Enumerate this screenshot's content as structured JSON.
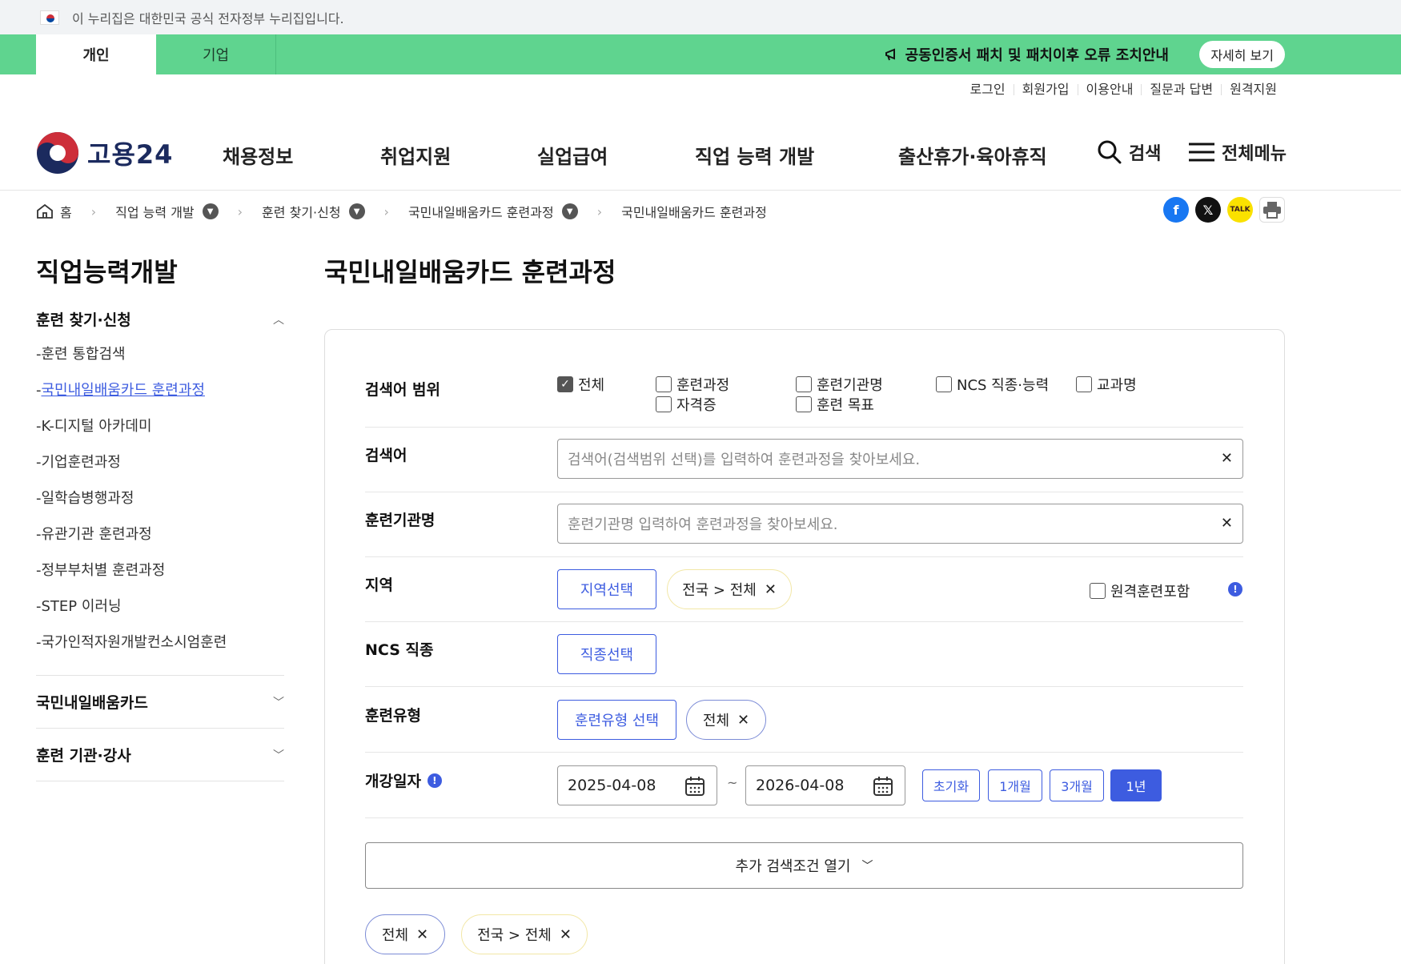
{
  "gov_banner": {
    "text": "이 누리집은 대한민국 공식 전자정부 누리집입니다."
  },
  "topbar": {
    "tab_personal": "개인",
    "tab_business": "기업",
    "notice": "공동인증서 패치 및 패치이후 오류 조치안내",
    "detail_button": "자세히 보기"
  },
  "util_links": [
    "로그인",
    "회원가입",
    "이용안내",
    "질문과 답변",
    "원격지원"
  ],
  "logo": {
    "text": "고용24"
  },
  "gnb": {
    "menus": [
      "채용정보",
      "취업지원",
      "실업급여",
      "직업 능력 개발",
      "출산휴가·육아휴직"
    ],
    "search": "검색",
    "all_menu": "전체메뉴"
  },
  "breadcrumb": {
    "home": "홈",
    "items": [
      "직업 능력 개발",
      "훈련 찾기·신청",
      "국민내일배움카드 훈련과정",
      "국민내일배움카드 훈련과정"
    ]
  },
  "share": {
    "kakao": "TALK"
  },
  "lnb": {
    "title": "직업능력개발",
    "group_open": "훈련 찾기·신청",
    "items": [
      "훈련 통합검색",
      "국민내일배움카드 훈련과정",
      "K-디지털 아카데미",
      "기업훈련과정",
      "일학습병행과정",
      "유관기관 훈련과정",
      "정부부처별 훈련과정",
      "STEP 이러닝",
      "국가인적자원개발컨소시엄훈련"
    ],
    "active_index": 1,
    "group_2": "국민내일배움카드",
    "group_3": "훈련 기관·강사"
  },
  "page": {
    "title": "국민내일배움카드 훈련과정"
  },
  "form": {
    "scope_label": "검색어 범위",
    "scope_options": [
      {
        "label": "전체",
        "checked": true
      },
      {
        "label": "훈련과정",
        "checked": false
      },
      {
        "label": "자격증",
        "checked": false
      },
      {
        "label": "훈련기관명",
        "checked": false
      },
      {
        "label": "훈련 목표",
        "checked": false
      },
      {
        "label": "NCS 직종·능력",
        "checked": false
      },
      {
        "label": "교과명",
        "checked": false
      }
    ],
    "keyword_label": "검색어",
    "keyword_placeholder": "검색어(검색범위 선택)를 입력하여 훈련과정을 찾아보세요.",
    "institution_label": "훈련기관명",
    "institution_placeholder": "훈련기관명 입력하여 훈련과정을 찾아보세요.",
    "region_label": "지역",
    "region_button": "지역선택",
    "region_chip": "전국 > 전체",
    "remote_label": "원격훈련포함",
    "ncs_label": "NCS 직종",
    "ncs_button": "직종선택",
    "type_label": "훈련유형",
    "type_button": "훈련유형 선택",
    "type_chip": "전체",
    "date_label": "개강일자",
    "date_start": "2025-04-08",
    "date_tilde": "~",
    "date_end": "2026-04-08",
    "period_buttons": [
      "초기화",
      "1개월",
      "3개월",
      "1년"
    ],
    "period_active_index": 3,
    "more_button": "추가 검색조건 열기",
    "selected_chips": [
      "전체",
      "전국 > 전체"
    ]
  },
  "colors": {
    "green": "#5fd48f",
    "accent": "#3d5ce0",
    "chip_yellow": "#f2e7a6"
  }
}
